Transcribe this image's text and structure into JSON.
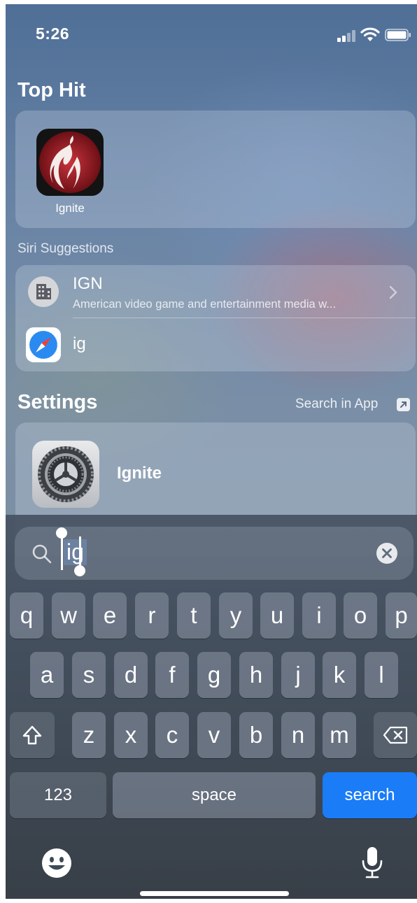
{
  "status_bar": {
    "time": "5:26"
  },
  "top_hit": {
    "title": "Top Hit",
    "app_name": "Ignite"
  },
  "siri": {
    "title": "Siri Suggestions",
    "items": [
      {
        "title": "IGN",
        "subtitle": "American video game and entertainment media w..."
      },
      {
        "title": "ig"
      }
    ]
  },
  "settings": {
    "title": "Settings",
    "search_in_app": "Search in App",
    "result": "Ignite"
  },
  "search": {
    "query": "ig"
  },
  "keyboard": {
    "row1": [
      "q",
      "w",
      "e",
      "r",
      "t",
      "y",
      "u",
      "i",
      "o",
      "p"
    ],
    "row2": [
      "a",
      "s",
      "d",
      "f",
      "g",
      "h",
      "j",
      "k",
      "l"
    ],
    "row3": [
      "z",
      "x",
      "c",
      "v",
      "b",
      "n",
      "m"
    ],
    "numbers_label": "123",
    "space_label": "space",
    "search_label": "search"
  },
  "colors": {
    "accent": "#1a7cf7"
  }
}
